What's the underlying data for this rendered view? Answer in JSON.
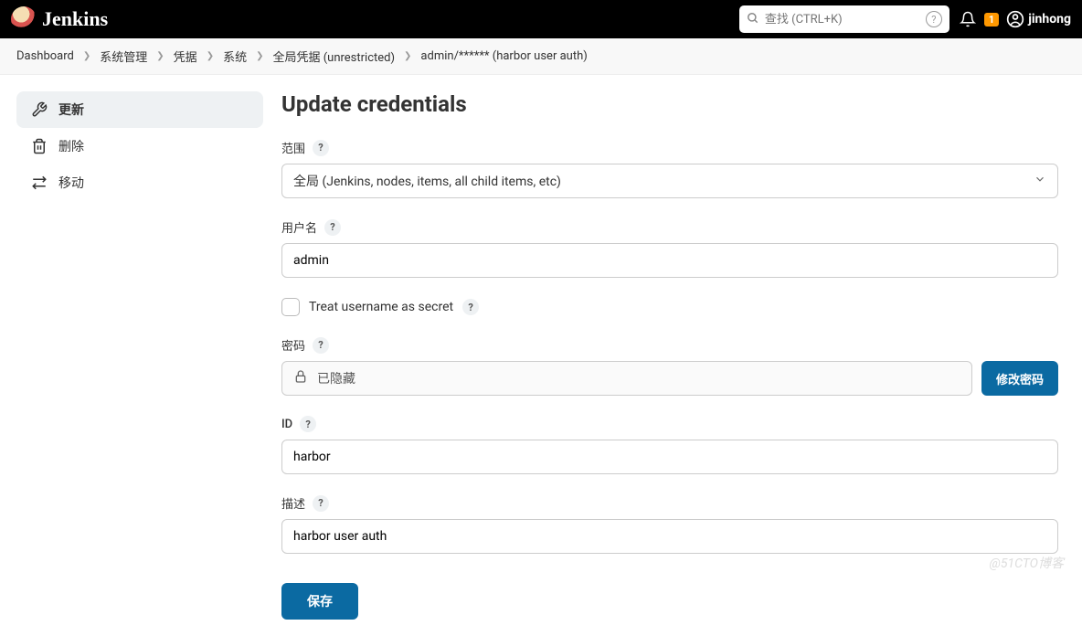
{
  "header": {
    "brand": "Jenkins",
    "search_placeholder": "查找 (CTRL+K)",
    "notification_count": "1",
    "username": "jinhong"
  },
  "breadcrumb": {
    "items": [
      "Dashboard",
      "系统管理",
      "凭据",
      "系统",
      "全局凭据 (unrestricted)",
      "admin/****** (harbor user auth)"
    ]
  },
  "sidebar": {
    "items": [
      {
        "label": "更新"
      },
      {
        "label": "删除"
      },
      {
        "label": "移动"
      }
    ]
  },
  "page": {
    "title": "Update credentials"
  },
  "form": {
    "scope_label": "范围",
    "scope_value": "全局 (Jenkins, nodes, items, all child items, etc)",
    "username_label": "用户名",
    "username_value": "admin",
    "treat_secret_label": "Treat username as secret",
    "password_label": "密码",
    "password_hidden_text": "已隐藏",
    "change_password_btn": "修改密码",
    "id_label": "ID",
    "id_value": "harbor",
    "description_label": "描述",
    "description_value": "harbor user auth",
    "save_btn": "保存"
  },
  "watermark": "@51CTO博客"
}
